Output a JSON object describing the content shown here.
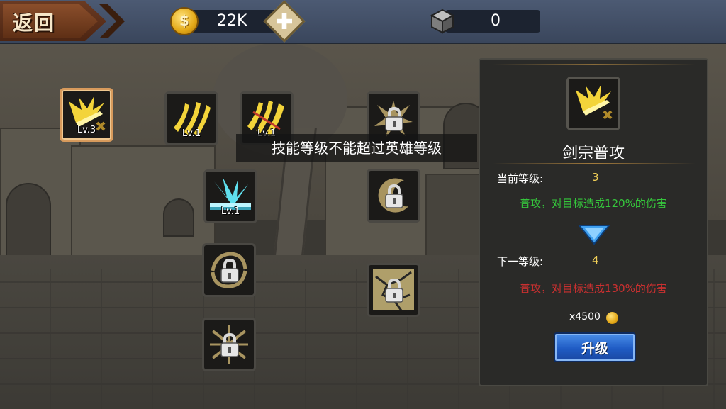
{
  "topbar": {
    "back_label": "返回",
    "coin_symbol": "$",
    "coin_value": "22K",
    "material_value": "0"
  },
  "skills": [
    {
      "id": "sword-wave",
      "level_label": "Lv.3",
      "locked": false,
      "selected": true
    },
    {
      "id": "triple-slash",
      "level_label": "Lv.1",
      "locked": false
    },
    {
      "id": "storm-slash",
      "level_label": "Lv.1",
      "locked": false
    },
    {
      "id": "ground-burst",
      "level_label": "Lv.1",
      "locked": false
    },
    {
      "id": "spiral",
      "locked": true
    },
    {
      "id": "sunburst",
      "locked": true
    },
    {
      "id": "explosion",
      "locked": true
    },
    {
      "id": "crescent",
      "locked": true
    },
    {
      "id": "crack",
      "locked": true
    }
  ],
  "tooltip": "技能等级不能超过英雄等级",
  "panel": {
    "skill_name": "剑宗普攻",
    "current_level_label": "当前等级:",
    "current_level": "3",
    "current_desc": "普攻，对目标造成120%的伤害",
    "next_level_label": "下一等级:",
    "next_level": "4",
    "next_desc": "普攻，对目标造成130%的伤害",
    "cost": "x4500",
    "upgrade_label": "升级"
  },
  "colors": {
    "current_desc": "#35c63c",
    "next_desc": "#c93030",
    "level_value": "#f1cf57",
    "selected_border": "#d79a5c"
  }
}
